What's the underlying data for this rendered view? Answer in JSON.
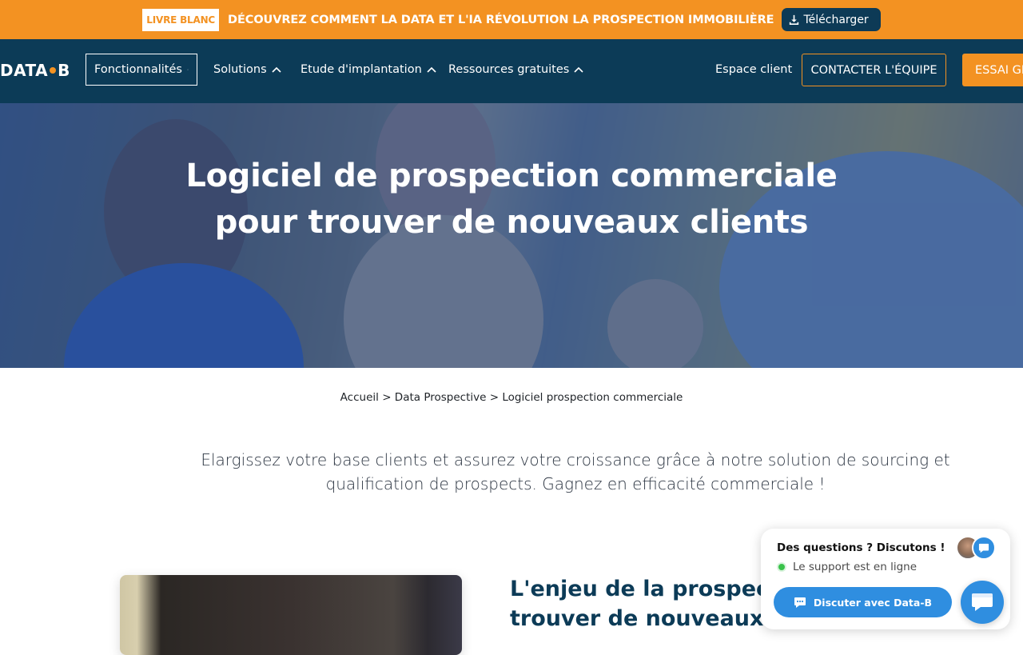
{
  "promo": {
    "badge": "LIVRE BLANC",
    "text": "DÉCOUVREZ COMMENT LA DATA ET L'IA RÉVOLUTION LA PROSPECTION IMMOBILIÈRE",
    "button_label": "Télécharger",
    "button_icon": "download-icon"
  },
  "nav": {
    "logo_left": "DATA",
    "logo_right": "B",
    "items": [
      {
        "label": "Fonctionnalités",
        "icon": "chevron-up-icon",
        "active": true
      },
      {
        "label": "Solutions",
        "icon": "chevron-up-icon"
      },
      {
        "label": "Etude d'implantation",
        "icon": "chevron-up-icon"
      },
      {
        "label": "Ressources gratuites",
        "icon": "chevron-up-icon"
      }
    ],
    "client_space": "Espace client",
    "contact_button": "CONTACTER L'ÉQUIPE",
    "trial_button": "ESSAI GR"
  },
  "hero": {
    "title_line1": "Logiciel de prospection commerciale",
    "title_line2": "pour trouver de nouveaux clients"
  },
  "breadcrumb": {
    "items": [
      "Accueil",
      "Data Prospective",
      "Logiciel prospection commerciale"
    ],
    "separator": ">"
  },
  "lead": {
    "line1": "Elargissez votre base clients et assurez votre croissance grâce à notre solution de sourcing et",
    "line2": "qualification de prospects. Gagnez en efficacité commerciale !"
  },
  "section": {
    "title_line1": "L'enjeu de la prospectio",
    "title_line2": "trouver de nouveaux cli"
  },
  "chat": {
    "title": "Des questions ? Discutons !",
    "status": "Le support est en ligne",
    "button_label": "Discuter avec Data-B",
    "button_icon": "chat-icon",
    "fab_icon": "chat-bubble-icon"
  },
  "colors": {
    "orange": "#f39222",
    "navy": "#0c3b57",
    "chat_blue": "#2f8ee0",
    "online_green": "#39c24a"
  }
}
